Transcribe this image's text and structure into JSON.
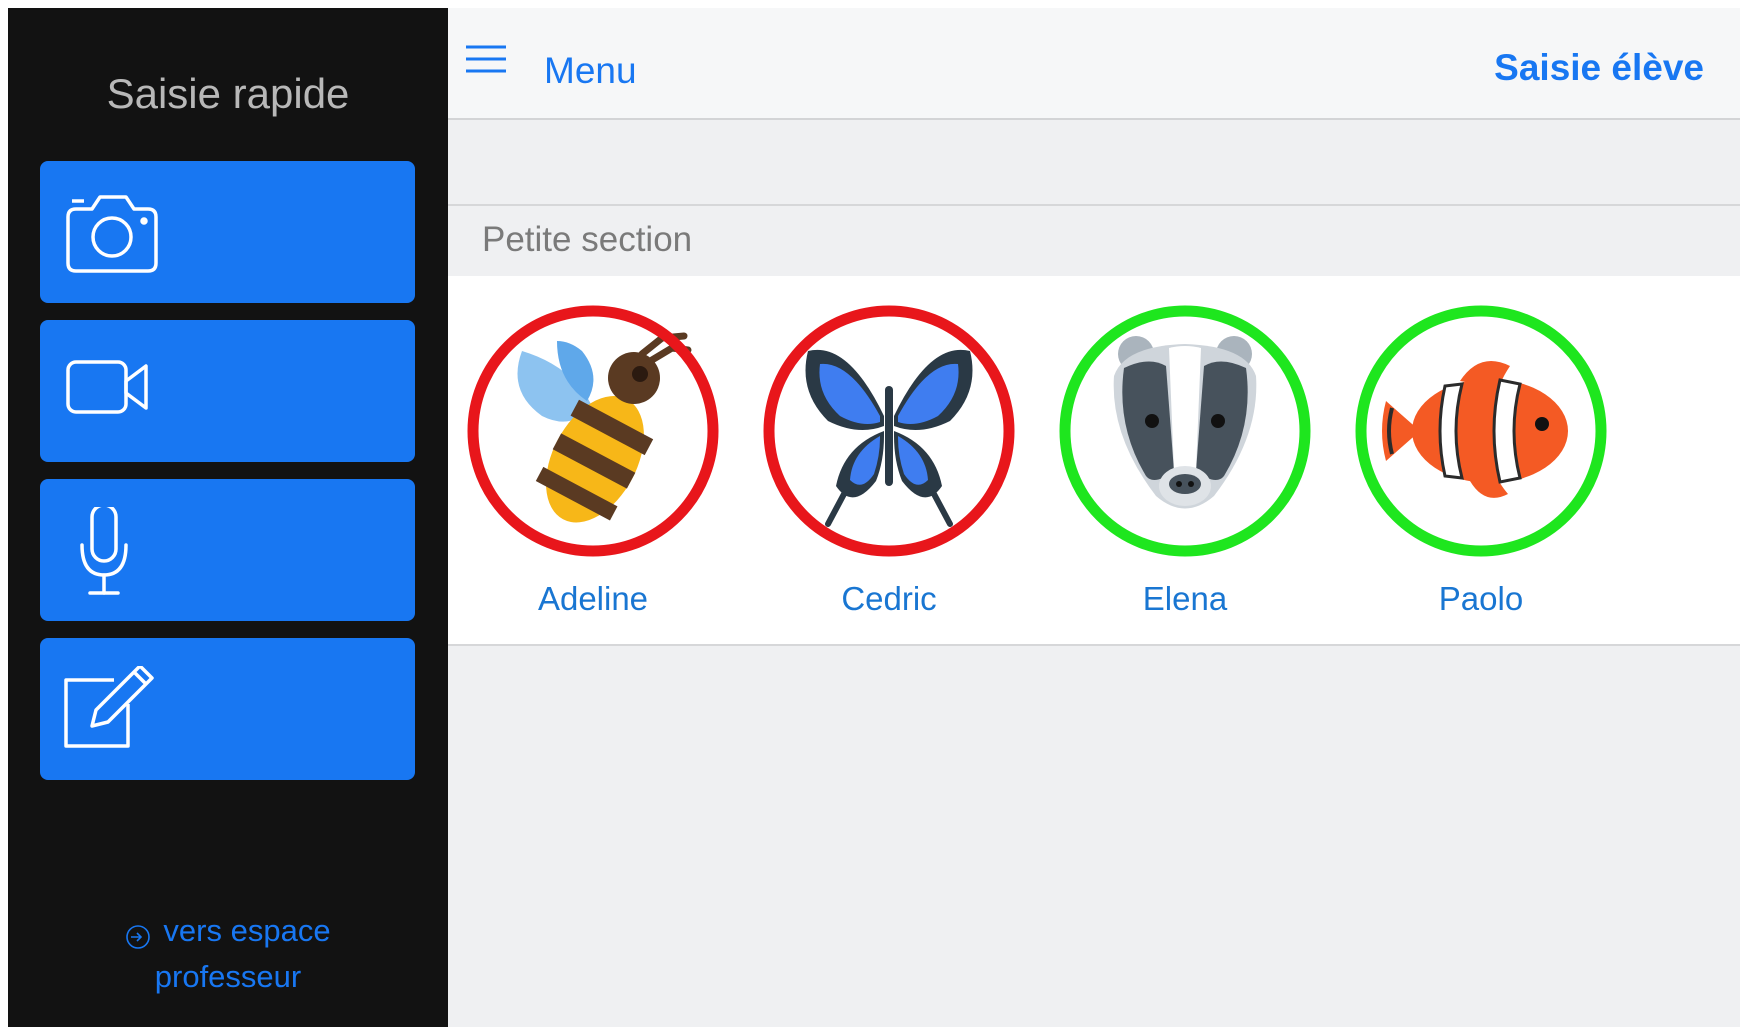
{
  "sidebar": {
    "title": "Saisie rapide",
    "buttons": [
      {
        "name": "photo",
        "icon": "camera-icon"
      },
      {
        "name": "video",
        "icon": "video-camera-icon"
      },
      {
        "name": "audio",
        "icon": "microphone-icon"
      },
      {
        "name": "note",
        "icon": "edit-note-icon"
      }
    ],
    "teacher_link": {
      "line1": "vers espace",
      "line2": "professeur",
      "icon": "login-icon"
    }
  },
  "header": {
    "menu_label": "Menu",
    "menu_icon": "hamburger-icon",
    "page_title": "Saisie élève"
  },
  "section": {
    "label": "Petite section",
    "students": [
      {
        "name": "Adeline",
        "avatar": "bee-icon",
        "status": "red",
        "ring_color": "#e8161b"
      },
      {
        "name": "Cedric",
        "avatar": "butterfly-icon",
        "status": "red",
        "ring_color": "#e8161b"
      },
      {
        "name": "Elena",
        "avatar": "badger-icon",
        "status": "green",
        "ring_color": "#1ee61e"
      },
      {
        "name": "Paolo",
        "avatar": "clownfish-icon",
        "status": "green",
        "ring_color": "#1ee61e"
      }
    ]
  },
  "colors": {
    "accent": "#1877f2",
    "sidebar_bg": "#121212",
    "main_bg": "#eff0f2"
  }
}
